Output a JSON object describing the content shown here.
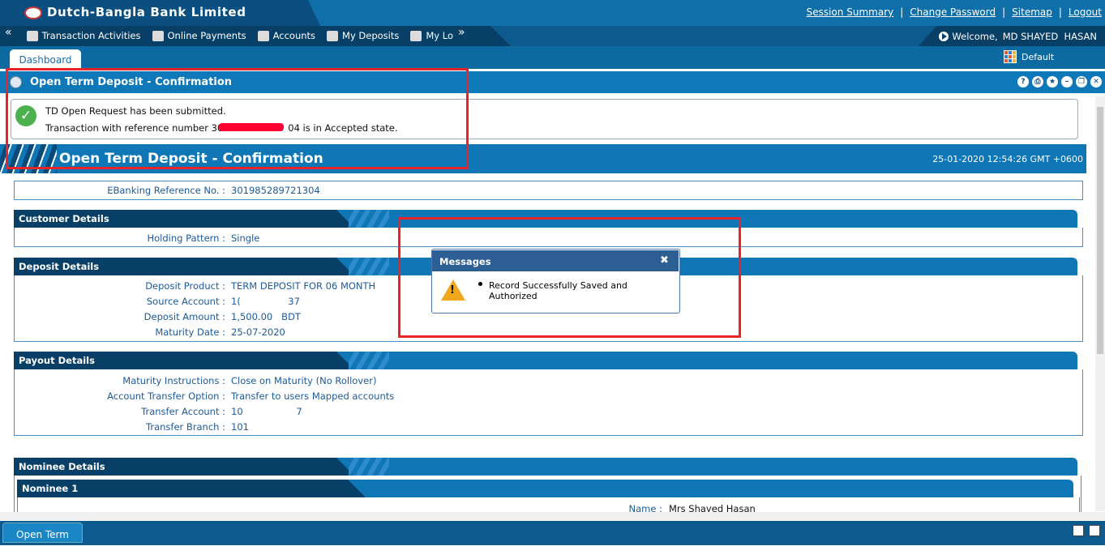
{
  "header": {
    "bank_name": "Dutch-Bangla Bank Limited",
    "links": [
      "Session Summary",
      "Change Password",
      "Sitemap",
      "Logout"
    ],
    "separator": "|"
  },
  "nav": {
    "prev": "«",
    "next": "»",
    "items": [
      "Transaction Activities",
      "Online Payments",
      "Accounts",
      "My Deposits",
      "My Lo"
    ],
    "welcome_prefix": "Welcome,",
    "user_name": "MD SHAYED  HASAN"
  },
  "tabs": {
    "active": "Dashboard",
    "layout_label": "Default"
  },
  "portlet": {
    "title": "Open Term Deposit - Confirmation",
    "controls": [
      "?",
      "⎙",
      "★",
      "–",
      "❐",
      "✕"
    ]
  },
  "success": {
    "line1": "TD Open Request has been submitted.",
    "line2_prefix": "Transaction with reference number 30",
    "line2_suffix": "04 is in Accepted state."
  },
  "page": {
    "heading": "Open Term Deposit - Confirmation",
    "datetime": "25-01-2020 12:54:26 GMT +0600",
    "ebanking_ref_label": "EBanking Reference No. :",
    "ebanking_ref_value": "301985289721304"
  },
  "customer": {
    "title": "Customer Details",
    "holding_label": "Holding Pattern :",
    "holding_value": "Single"
  },
  "deposit": {
    "title": "Deposit Details",
    "product_label": "Deposit Product :",
    "product_value": "TERM DEPOSIT FOR 06 MONTH",
    "source_label": "Source Account :",
    "source_value": "1(                37",
    "amount_label": "Deposit Amount :",
    "amount_value": "1,500.00   BDT",
    "maturity_label": "Maturity Date :",
    "maturity_value": "25-07-2020"
  },
  "payout": {
    "title": "Payout Details",
    "instr_label": "Maturity Instructions :",
    "instr_value": "Close on Maturity (No Rollover)",
    "option_label": "Account Transfer Option :",
    "option_value": "Transfer to users Mapped accounts",
    "account_label": "Transfer Account :",
    "account_value": "10                  7",
    "branch_label": "Transfer Branch :",
    "branch_value": "101"
  },
  "nominee": {
    "title": "Nominee Details",
    "sub_title": "Nominee 1",
    "name_label": "Name :",
    "name_value": "Mrs Shayed Hasan"
  },
  "message": {
    "title": "Messages",
    "close": "✖",
    "text": "Record Successfully Saved and Authorized"
  },
  "bottom": {
    "tab": "Open Term"
  }
}
